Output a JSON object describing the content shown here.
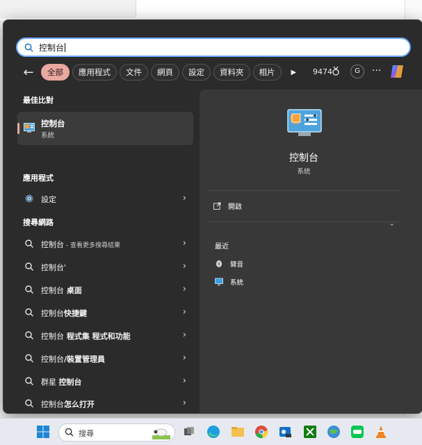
{
  "search": {
    "query": "控制台"
  },
  "filters": {
    "chips": [
      "全部",
      "應用程式",
      "文件",
      "網頁",
      "設定",
      "資料夾",
      "相片"
    ],
    "points": "9474",
    "avatar_letter": "G",
    "more": "···"
  },
  "left": {
    "best_match_heading": "最佳比對",
    "best": {
      "title": "控制台",
      "subtitle": "系統"
    },
    "apps_heading": "應用程式",
    "apps": [
      {
        "label": "設定"
      }
    ],
    "web_heading": "搜尋網路",
    "web": [
      {
        "bold": "控制台",
        "rest": "",
        "note": " - 查看更多搜尋結果"
      },
      {
        "bold": "控制台'",
        "rest": "",
        "note": ""
      },
      {
        "bold": "控制台",
        "rest": " 桌面",
        "note": ""
      },
      {
        "bold": "控制台",
        "rest": "快捷鍵",
        "note": ""
      },
      {
        "bold": "控制台",
        "rest": " 程式集 程式和功能",
        "note": ""
      },
      {
        "bold": "控制台",
        "rest": "/裝置管理員",
        "note": ""
      },
      {
        "bold": "群星 ",
        "rest": "控制台",
        "note": ""
      },
      {
        "bold": "控制台",
        "rest": "怎么打开",
        "note": ""
      }
    ]
  },
  "right": {
    "title": "控制台",
    "subtitle": "系統",
    "open_label": "開啟",
    "recent_heading": "最近",
    "recent": [
      "聲音",
      "系統"
    ]
  },
  "taskbar": {
    "search_placeholder": "搜尋"
  },
  "colors": {
    "accent_chip": "#e9a8a0",
    "search_border": "#6aa8ff",
    "panel_bg": "#2b2b2b"
  }
}
